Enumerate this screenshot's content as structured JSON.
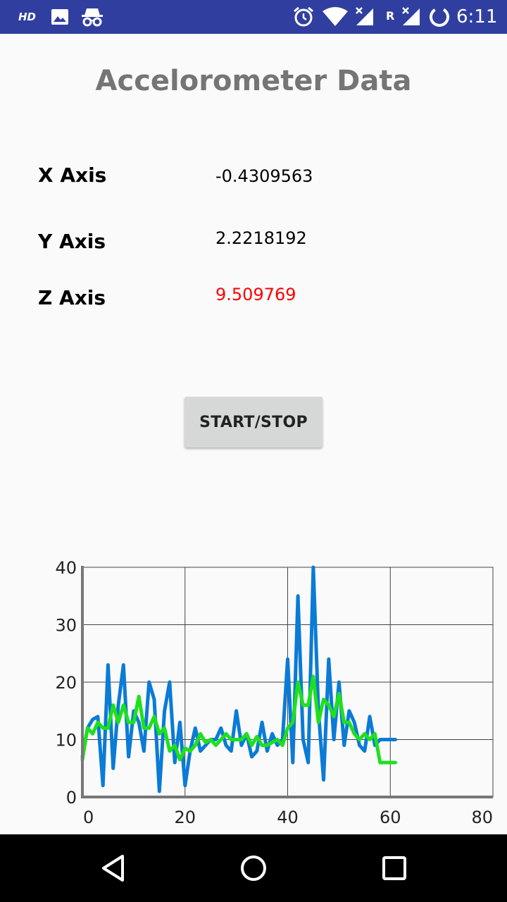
{
  "status_bar": {
    "hd_label": "HD",
    "carrier_label": "R",
    "time": "6:11",
    "icons": [
      "image-icon",
      "incognito-icon",
      "alarm-icon",
      "wifi-icon",
      "signal-icon",
      "signal-roaming-icon",
      "battery-saver-icon"
    ]
  },
  "title": "Accelorometer Data",
  "readings": {
    "x_label": "X Axis",
    "x_value": "-0.4309563",
    "y_label": "Y Axis",
    "y_value": "2.2218192",
    "z_label": "Z Axis",
    "z_value": "9.509769",
    "z_value_color": "#ff0000"
  },
  "button": {
    "label": "START/STOP"
  },
  "nav": {
    "icons": [
      "back-icon",
      "home-icon",
      "recents-icon"
    ]
  },
  "colors": {
    "status_bar": "#303f9f",
    "series_raw": "#0a7bd6",
    "series_filtered": "#1ee01e"
  },
  "chart_data": {
    "type": "line",
    "title": "",
    "xlabel": "",
    "ylabel": "",
    "xlim": [
      0,
      80
    ],
    "ylim": [
      0,
      40
    ],
    "x_ticks": [
      0,
      20,
      40,
      60,
      80
    ],
    "y_ticks": [
      0,
      10,
      20,
      30,
      40
    ],
    "grid": true,
    "series": [
      {
        "color": "#0a7bd6",
        "x": [
          0,
          1,
          2,
          3,
          4,
          5,
          6,
          7,
          8,
          9,
          10,
          11,
          12,
          13,
          14,
          15,
          16,
          17,
          18,
          19,
          20,
          21,
          22,
          23,
          24,
          25,
          26,
          27,
          28,
          29,
          30,
          31,
          32,
          33,
          34,
          35,
          36,
          37,
          38,
          39,
          40,
          41,
          42,
          43,
          44,
          45,
          46,
          47,
          48,
          49,
          50,
          51,
          52,
          53,
          54,
          55,
          56,
          57,
          58,
          59,
          60,
          61
        ],
        "values": [
          7,
          12,
          13.5,
          14,
          2,
          23,
          5,
          16,
          23,
          7,
          15,
          13,
          8,
          20,
          17,
          1,
          15,
          20,
          6,
          13,
          2,
          8,
          12,
          8,
          9,
          10,
          10,
          12,
          9,
          8,
          15,
          9,
          11,
          7,
          8,
          13,
          8,
          11,
          9,
          10,
          24,
          6,
          35,
          10,
          6,
          40,
          15,
          3,
          24,
          10,
          20,
          9,
          15,
          13,
          9,
          8,
          14,
          9,
          10,
          10,
          10,
          10
        ]
      },
      {
        "color": "#1ee01e",
        "x": [
          0,
          1,
          2,
          3,
          4,
          5,
          6,
          7,
          8,
          9,
          10,
          11,
          12,
          13,
          14,
          15,
          16,
          17,
          18,
          19,
          20,
          21,
          22,
          23,
          24,
          25,
          26,
          27,
          28,
          29,
          30,
          31,
          32,
          33,
          34,
          35,
          36,
          37,
          38,
          39,
          40,
          41,
          42,
          43,
          44,
          45,
          46,
          47,
          48,
          49,
          50,
          51,
          52,
          53,
          54,
          55,
          56,
          57,
          58,
          59,
          60,
          61
        ],
        "values": [
          6.5,
          12,
          11,
          13,
          12,
          12,
          16,
          13,
          16,
          13,
          13,
          17.5,
          12,
          12,
          14,
          11,
          12,
          8,
          9,
          6.5,
          8.5,
          8,
          9,
          11,
          9.5,
          10,
          9,
          10,
          11,
          10,
          10,
          10,
          11,
          9,
          10.5,
          9,
          9,
          9.5,
          10,
          9,
          12,
          13,
          20,
          16,
          16,
          21,
          13,
          17,
          16,
          14,
          18,
          13,
          13,
          11,
          10,
          11,
          10,
          11,
          6,
          6,
          6,
          6
        ]
      }
    ]
  }
}
